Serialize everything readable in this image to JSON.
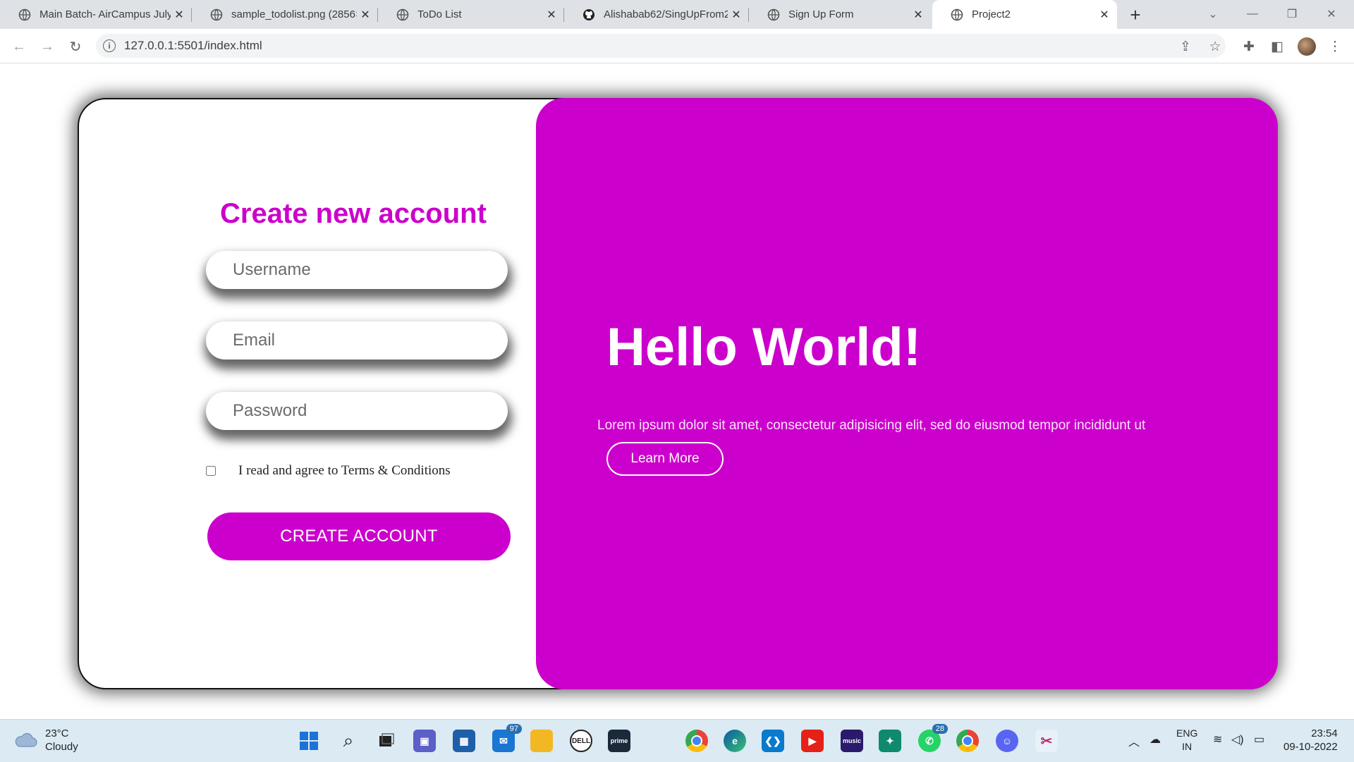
{
  "browser": {
    "tabs": [
      {
        "title": "Main Batch- AirCampus July",
        "active": false
      },
      {
        "title": "sample_todolist.png (2856×",
        "active": false
      },
      {
        "title": "ToDo List",
        "active": false
      },
      {
        "title": "Alishabab62/SingUpFrom2",
        "active": false
      },
      {
        "title": "Sign Up Form",
        "active": false
      },
      {
        "title": "Project2",
        "active": true
      }
    ],
    "url": "127.0.0.1:5501/index.html"
  },
  "page": {
    "heading": "Create new account",
    "fields": {
      "username_placeholder": "Username",
      "email_placeholder": "Email",
      "password_placeholder": "Password"
    },
    "terms_label": "I read and agree to Terms & Conditions",
    "create_button": "CREATE ACCOUNT",
    "hello": "Hello World!",
    "lorem": "Lorem ipsum dolor sit amet, consectetur adipisicing elit, sed do eiusmod tempor incididunt ut",
    "learn_button": "Learn More",
    "accent_color": "#cc00cc"
  },
  "taskbar": {
    "temperature": "23°C",
    "weather": "Cloudy",
    "mail_badge": "97",
    "whatsapp_badge": "28",
    "lang_primary": "ENG",
    "lang_region": "IN",
    "time": "23:54",
    "date": "09-10-2022"
  }
}
